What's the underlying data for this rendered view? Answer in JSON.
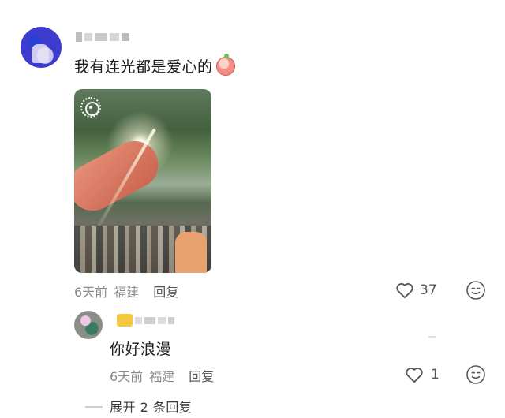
{
  "comment": {
    "text": "我有连光都是爱心的",
    "emoji": "peach-face-emoji",
    "time": "6天前",
    "location": "福建",
    "reply_label": "回复",
    "likes": "37",
    "has_live_photo": true
  },
  "reply": {
    "text": "你好浪漫",
    "time": "6天前",
    "location": "福建",
    "reply_label": "回复",
    "likes": "1"
  },
  "expand": {
    "label": "展开 2 条回复"
  },
  "icons": {
    "like": "heart-outline-icon",
    "emoji": "smiley-face-icon",
    "live": "live-photo-icon"
  },
  "colors": {
    "meta_text": "#8a8a8a",
    "body_text": "#1a1a1a",
    "icon": "#555555"
  }
}
